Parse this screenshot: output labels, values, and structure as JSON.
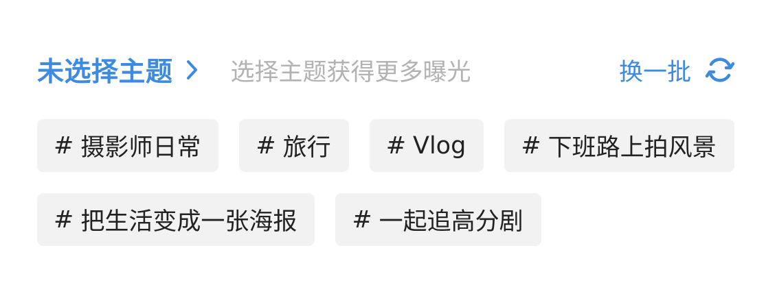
{
  "header": {
    "title": "未选择主题",
    "hint": "选择主题获得更多曝光",
    "refresh_label": "换一批",
    "accent_color": "#3d8be0",
    "chevron_icon": "chevron-right-icon",
    "refresh_icon": "refresh-icon"
  },
  "tag_prefix": "#",
  "tags": [
    [
      "摄影师日常",
      "旅行",
      "Vlog",
      "下班路上拍风景"
    ],
    [
      "把生活变成一张海报",
      "一起追高分剧"
    ]
  ]
}
